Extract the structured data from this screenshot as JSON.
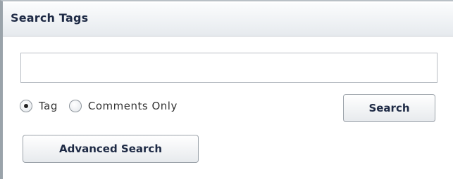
{
  "panel": {
    "title": "Search Tags"
  },
  "search": {
    "value": "",
    "placeholder": ""
  },
  "options": [
    {
      "label": "Tag",
      "selected": true
    },
    {
      "label": "Comments Only",
      "selected": false
    }
  ],
  "buttons": {
    "search_label": "Search",
    "advanced_label": "Advanced Search"
  }
}
